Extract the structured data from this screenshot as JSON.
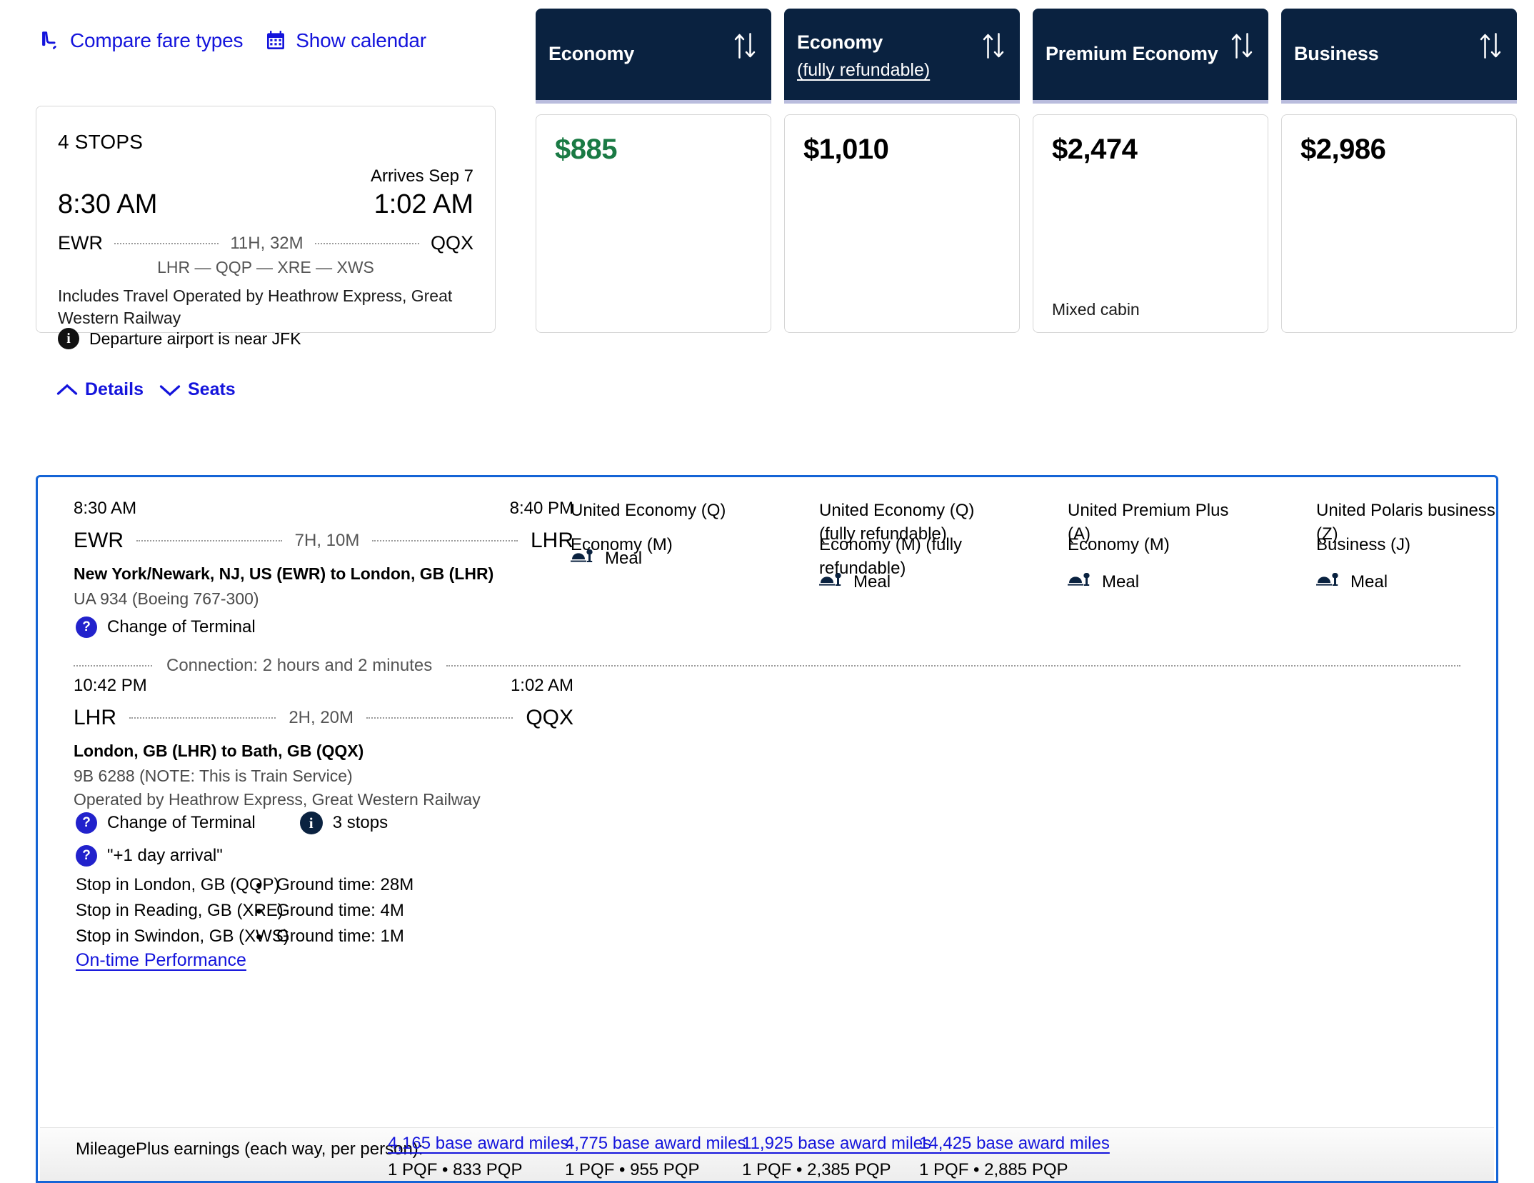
{
  "toolbar": {
    "compare_fare_types": "Compare fare types",
    "show_calendar": "Show calendar"
  },
  "fare_columns": [
    {
      "title": "Economy",
      "subtitle": "",
      "price": "$885",
      "price_is_green": true,
      "note": ""
    },
    {
      "title": "Economy",
      "subtitle": "(fully refundable)",
      "price": "$1,010",
      "price_is_green": false,
      "note": ""
    },
    {
      "title": "Premium Economy",
      "subtitle": "",
      "price": "$2,474",
      "price_is_green": false,
      "note": "Mixed cabin"
    },
    {
      "title": "Business",
      "subtitle": "",
      "price": "$2,986",
      "price_is_green": false,
      "note": ""
    }
  ],
  "summary": {
    "stops": "4 STOPS",
    "arrives": "Arrives Sep 7",
    "depart_time": "8:30 AM",
    "arrive_time": "1:02 AM",
    "origin": "EWR",
    "destination": "QQX",
    "duration": "11H, 32M",
    "via": "LHR — QQP — XRE — XWS",
    "includes": "Includes Travel Operated by Heathrow Express, Great Western Railway",
    "near_note": "Departure airport is near JFK",
    "details_label": "Details",
    "seats_label": "Seats"
  },
  "segments": [
    {
      "depart_time": "8:30 AM",
      "arrive_time": "8:40 PM",
      "origin": "EWR",
      "destination": "LHR",
      "duration": "7H, 10M",
      "city_pair": "New York/Newark, NJ, US (EWR) to London, GB (LHR)",
      "flight": "UA 934 (Boeing 767-300)",
      "operated_by": "",
      "badges": [
        {
          "type": "question",
          "text": "Change of Terminal"
        }
      ],
      "fares": [
        {
          "label": "United Economy (Q)",
          "meal": "Meal"
        },
        {
          "label": "United Economy (Q) (fully refundable)",
          "meal": "Meal"
        },
        {
          "label": "United Premium Plus (A)",
          "meal": "Meal"
        },
        {
          "label": "United Polaris business (Z)",
          "meal": "Meal"
        }
      ]
    },
    {
      "depart_time": "10:42 PM",
      "arrive_time": "1:02 AM",
      "origin": "LHR",
      "destination": "QQX",
      "duration": "2H, 20M",
      "city_pair": "London, GB (LHR) to Bath, GB (QQX)",
      "flight": "9B 6288 (NOTE: This is Train Service)",
      "operated_by": "Operated by Heathrow Express, Great Western Railway",
      "badges": [
        {
          "type": "question",
          "text": "Change of Terminal"
        },
        {
          "type": "info",
          "text": "3 stops"
        },
        {
          "type": "question",
          "text": "\"+1 day arrival\""
        }
      ],
      "fares": [
        {
          "label": "Economy (M)",
          "meal": ""
        },
        {
          "label": "Economy (M) (fully refundable)",
          "meal": ""
        },
        {
          "label": "Economy (M)",
          "meal": ""
        },
        {
          "label": "Business (J)",
          "meal": ""
        }
      ]
    }
  ],
  "connection": {
    "text": "Connection:  2 hours and 2 minutes"
  },
  "stops_detail": [
    {
      "place": "Stop in London, GB (QQP)",
      "ground": "Ground time:  28M"
    },
    {
      "place": "Stop in Reading, GB (XRE)",
      "ground": "Ground time:  4M"
    },
    {
      "place": "Stop in Swindon, GB (XWS)",
      "ground": "Ground time:  1M"
    }
  ],
  "on_time_performance": "On-time Performance",
  "mileage": {
    "label": "MileagePlus earnings (each way, per person):",
    "columns": [
      {
        "miles": "4,165 base award miles",
        "pqp": "1 PQF • 833 PQP"
      },
      {
        "miles": "4,775 base award miles",
        "pqp": "1 PQF • 955 PQP"
      },
      {
        "miles": "11,925 base award miles",
        "pqp": "1 PQF • 2,385 PQP"
      },
      {
        "miles": "14,425 base award miles",
        "pqp": "1 PQF • 2,885 PQP"
      }
    ]
  },
  "colors": {
    "header_navy": "#0a2240",
    "header_underbar": "#b9bcdd",
    "link_blue": "#1414dc",
    "panel_border_blue": "#1464d6",
    "price_green": "#1a7a44"
  }
}
